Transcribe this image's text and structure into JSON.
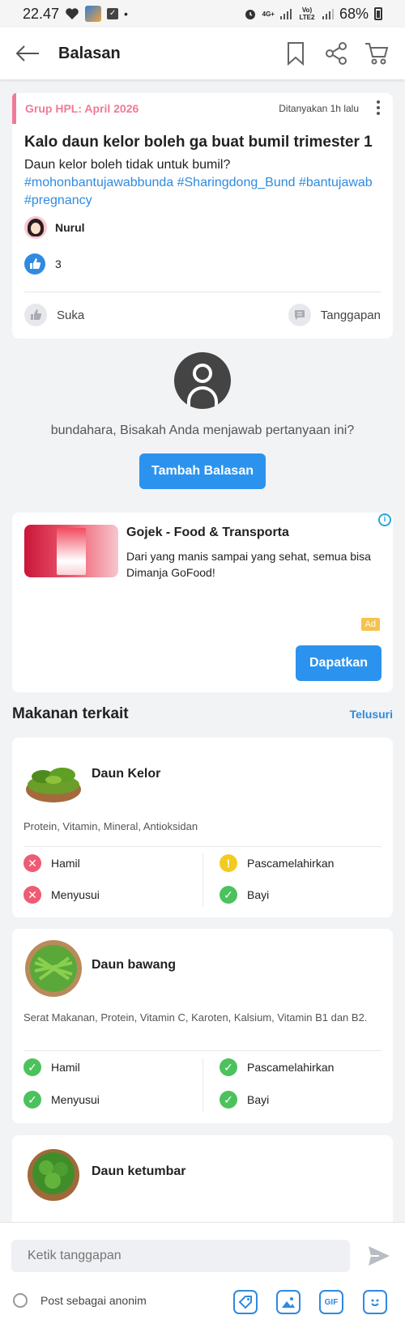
{
  "status_bar": {
    "time": "22.47",
    "network": "4G+",
    "carrier": "Vo) LTE2",
    "battery": "68%"
  },
  "header": {
    "title": "Balasan"
  },
  "question": {
    "group": "Grup HPL: April 2026",
    "time": "Ditanyakan 1h lalu",
    "title": "Kalo daun kelor boleh ga buat bumil trimester 1",
    "body": "Daun kelor boleh tidak untuk bumil?",
    "tags": "#mohonbantujawabbunda #Sharingdong_Bund #bantujawab #pregnancy",
    "user": "Nurul",
    "likes": "3",
    "like_label": "Suka",
    "reply_label": "Tanggapan"
  },
  "prompt": {
    "text": "bundahara, Bisakah Anda menjawab pertanyaan ini?",
    "button": "Tambah Balasan"
  },
  "ad": {
    "title": "Gojek - Food & Transporta",
    "description": "Dari yang manis sampai yang sehat, semua bisa Dimanja GoFood!",
    "badge": "Ad",
    "button": "Dapatkan"
  },
  "related": {
    "title": "Makanan terkait",
    "link": "Telusuri",
    "items": [
      {
        "name": "Daun Kelor",
        "nutrients": "Protein, Vitamin, Mineral, Antioksidan",
        "hamil": "Hamil",
        "pasca": "Pascamelahirkan",
        "menyusui": "Menyusui",
        "bayi": "Bayi",
        "hamil_status": "bad",
        "pasca_status": "warn",
        "menyusui_status": "bad",
        "bayi_status": "ok"
      },
      {
        "name": "Daun bawang",
        "nutrients": "Serat Makanan, Protein, Vitamin C, Karoten, Kalsium, Vitamin B1 dan B2.",
        "hamil": "Hamil",
        "pasca": "Pascamelahirkan",
        "menyusui": "Menyusui",
        "bayi": "Bayi",
        "hamil_status": "ok",
        "pasca_status": "ok",
        "menyusui_status": "ok",
        "bayi_status": "ok"
      },
      {
        "name": "Daun ketumbar"
      }
    ]
  },
  "composer": {
    "placeholder": "Ketik tanggapan",
    "anon_label": "Post sebagai anonim",
    "gif_label": "GIF"
  },
  "colors": {
    "accent": "#2b93ee",
    "pink": "#f07a98",
    "ok": "#4cc25d",
    "bad": "#ee5b73",
    "warn": "#f3cb20"
  }
}
